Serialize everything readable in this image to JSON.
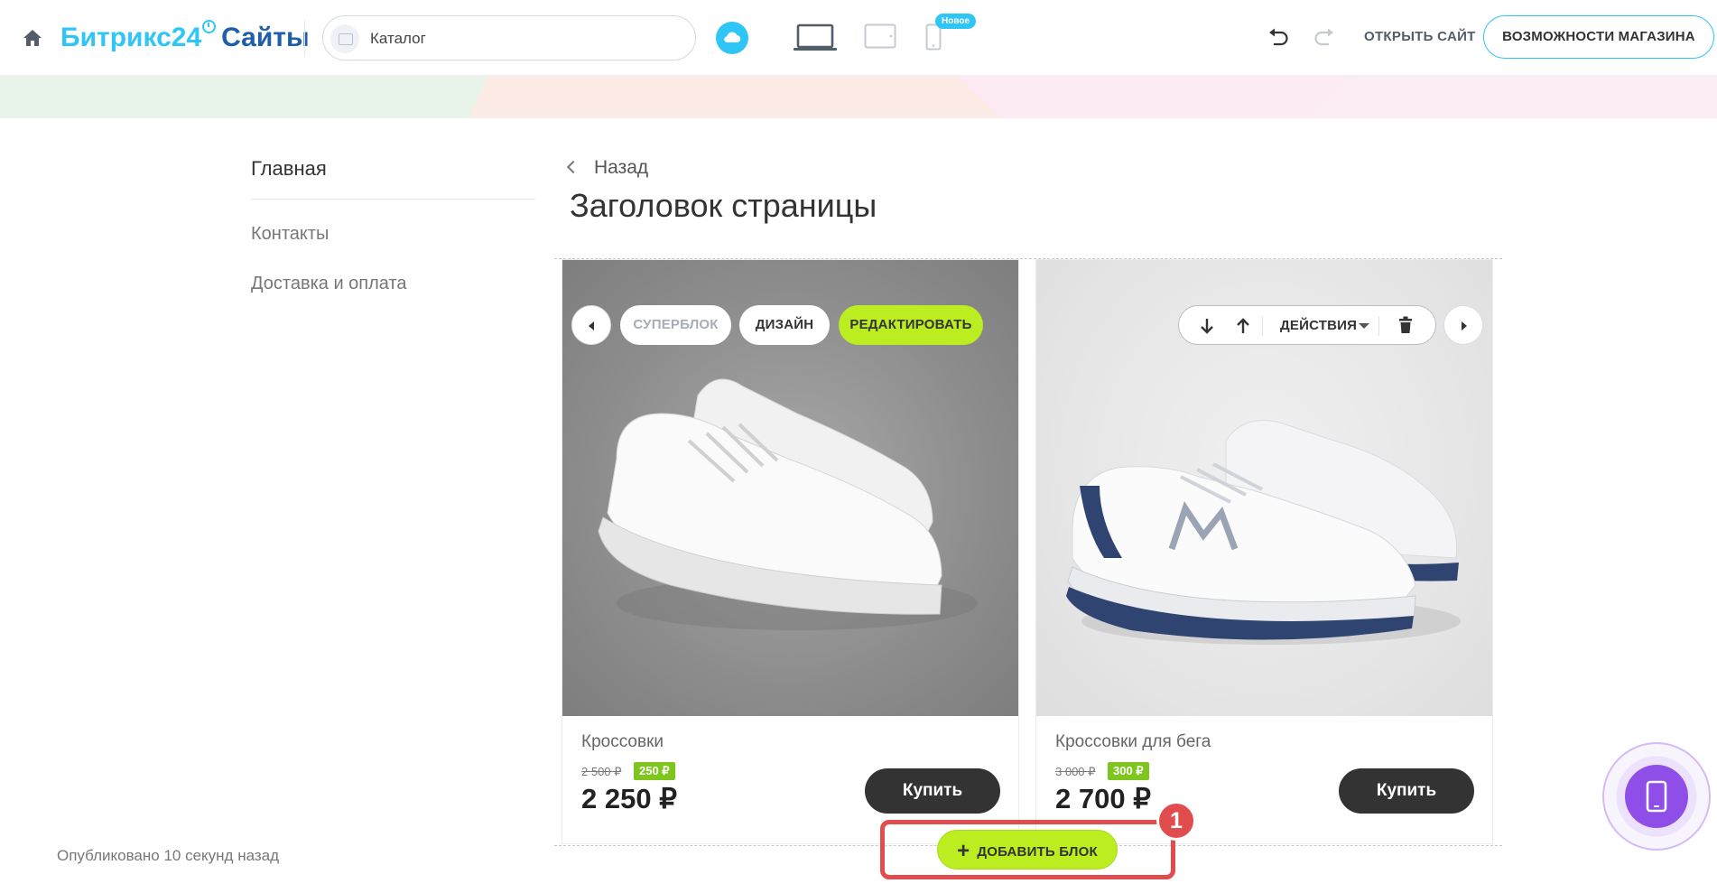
{
  "topbar": {
    "logo_brand": "Битрикс24",
    "logo_product": "Сайты",
    "catalog_label": "Каталог",
    "new_badge": "Новое",
    "open_site": "ОТКРЫТЬ САЙТ",
    "shop_features": "ВОЗМОЖНОСТИ МАГАЗИНА"
  },
  "menu": {
    "items": [
      {
        "label": "Главная"
      },
      {
        "label": "Контакты"
      },
      {
        "label": "Доставка и оплата"
      }
    ]
  },
  "page": {
    "back_label": "Назад",
    "title": "Заголовок страницы"
  },
  "block_toolbar": {
    "superblock": "СУПЕРБЛОК",
    "design": "ДИЗАЙН",
    "edit": "РЕДАКТИРОВАТЬ",
    "actions": "ДЕЙСТВИЯ"
  },
  "products": [
    {
      "name": "Кроссовки",
      "old_price": "2 500 ₽",
      "discount": "250 ₽",
      "price": "2 250 ₽",
      "buy_label": "Купить"
    },
    {
      "name": "Кроссовки для бега",
      "old_price": "3 000 ₽",
      "discount": "300 ₽",
      "price": "2 700 ₽",
      "buy_label": "Купить"
    }
  ],
  "footer": {
    "published": "Опубликовано 10 секунд назад",
    "add_block": "ДОБАВИТЬ БЛОК",
    "step_badge": "1"
  },
  "colors": {
    "accent_blue": "#2fc6f6",
    "brand_dark_blue": "#1f5ea8",
    "lime": "#bbed21",
    "discount_green": "#7ec51d",
    "highlight_red": "#e14d4f",
    "mobile_purple": "#8f4ee8"
  }
}
